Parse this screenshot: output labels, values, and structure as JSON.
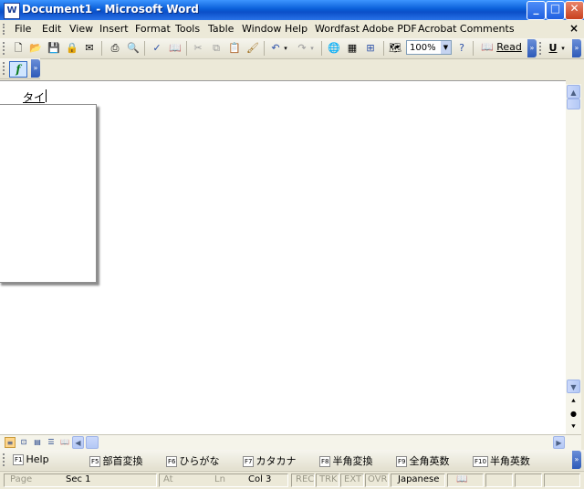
{
  "window": {
    "title": "Document1 - Microsoft Word",
    "app_icon": "word-doc-icon"
  },
  "menu": {
    "items": [
      "File",
      "Edit",
      "View",
      "Insert",
      "Format",
      "Tools",
      "Table",
      "Window",
      "Help",
      "Wordfast",
      "Adobe PDF",
      "Acrobat Comments"
    ],
    "close_glyph": "×"
  },
  "toolbar": {
    "zoom": "100%",
    "read_label": "Read",
    "underline_label": "U",
    "formula_label": "f"
  },
  "document": {
    "text": "タイ"
  },
  "fkeys": [
    {
      "key": "F1",
      "label": "Help"
    },
    {
      "key": "F5",
      "label": "部首変換"
    },
    {
      "key": "F6",
      "label": "ひらがな"
    },
    {
      "key": "F7",
      "label": "カタカナ"
    },
    {
      "key": "F8",
      "label": "半角変換"
    },
    {
      "key": "F9",
      "label": "全角英数"
    },
    {
      "key": "F10",
      "label": "半角英数"
    }
  ],
  "status": {
    "page": "Page",
    "sec": "Sec 1",
    "at": "At",
    "ln": "Ln",
    "col": "Col 3",
    "rec": "REC",
    "trk": "TRK",
    "ext": "EXT",
    "ovr": "OVR",
    "language": "Japanese"
  }
}
